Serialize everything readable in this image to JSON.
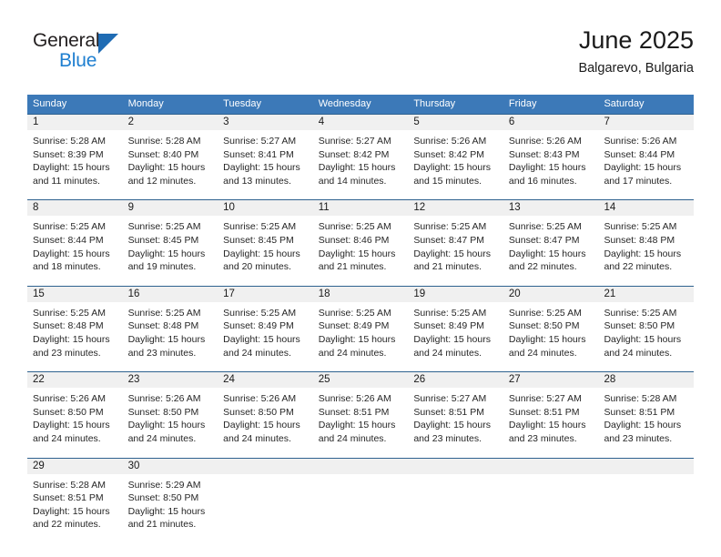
{
  "brand": {
    "name_top": "General",
    "name_bottom": "Blue",
    "triangle_icon": "triangle-icon",
    "colors": {
      "top_text": "#231f20",
      "bottom_text": "#1f7fd0",
      "triangle": "#1f6cb4"
    }
  },
  "header": {
    "title": "June 2025",
    "subtitle": "Balgarevo, Bulgaria"
  },
  "theme": {
    "header_blue": "#3c79b8",
    "rule_blue": "#2f628f",
    "day_band_gray": "#f0f0f0",
    "text": "#1a1a1a"
  },
  "weekdays": [
    "Sunday",
    "Monday",
    "Tuesday",
    "Wednesday",
    "Thursday",
    "Friday",
    "Saturday"
  ],
  "weeks": [
    [
      {
        "day": "1",
        "sunrise": "Sunrise: 5:28 AM",
        "sunset": "Sunset: 8:39 PM",
        "daylight1": "Daylight: 15 hours",
        "daylight2": "and 11 minutes."
      },
      {
        "day": "2",
        "sunrise": "Sunrise: 5:28 AM",
        "sunset": "Sunset: 8:40 PM",
        "daylight1": "Daylight: 15 hours",
        "daylight2": "and 12 minutes."
      },
      {
        "day": "3",
        "sunrise": "Sunrise: 5:27 AM",
        "sunset": "Sunset: 8:41 PM",
        "daylight1": "Daylight: 15 hours",
        "daylight2": "and 13 minutes."
      },
      {
        "day": "4",
        "sunrise": "Sunrise: 5:27 AM",
        "sunset": "Sunset: 8:42 PM",
        "daylight1": "Daylight: 15 hours",
        "daylight2": "and 14 minutes."
      },
      {
        "day": "5",
        "sunrise": "Sunrise: 5:26 AM",
        "sunset": "Sunset: 8:42 PM",
        "daylight1": "Daylight: 15 hours",
        "daylight2": "and 15 minutes."
      },
      {
        "day": "6",
        "sunrise": "Sunrise: 5:26 AM",
        "sunset": "Sunset: 8:43 PM",
        "daylight1": "Daylight: 15 hours",
        "daylight2": "and 16 minutes."
      },
      {
        "day": "7",
        "sunrise": "Sunrise: 5:26 AM",
        "sunset": "Sunset: 8:44 PM",
        "daylight1": "Daylight: 15 hours",
        "daylight2": "and 17 minutes."
      }
    ],
    [
      {
        "day": "8",
        "sunrise": "Sunrise: 5:25 AM",
        "sunset": "Sunset: 8:44 PM",
        "daylight1": "Daylight: 15 hours",
        "daylight2": "and 18 minutes."
      },
      {
        "day": "9",
        "sunrise": "Sunrise: 5:25 AM",
        "sunset": "Sunset: 8:45 PM",
        "daylight1": "Daylight: 15 hours",
        "daylight2": "and 19 minutes."
      },
      {
        "day": "10",
        "sunrise": "Sunrise: 5:25 AM",
        "sunset": "Sunset: 8:45 PM",
        "daylight1": "Daylight: 15 hours",
        "daylight2": "and 20 minutes."
      },
      {
        "day": "11",
        "sunrise": "Sunrise: 5:25 AM",
        "sunset": "Sunset: 8:46 PM",
        "daylight1": "Daylight: 15 hours",
        "daylight2": "and 21 minutes."
      },
      {
        "day": "12",
        "sunrise": "Sunrise: 5:25 AM",
        "sunset": "Sunset: 8:47 PM",
        "daylight1": "Daylight: 15 hours",
        "daylight2": "and 21 minutes."
      },
      {
        "day": "13",
        "sunrise": "Sunrise: 5:25 AM",
        "sunset": "Sunset: 8:47 PM",
        "daylight1": "Daylight: 15 hours",
        "daylight2": "and 22 minutes."
      },
      {
        "day": "14",
        "sunrise": "Sunrise: 5:25 AM",
        "sunset": "Sunset: 8:48 PM",
        "daylight1": "Daylight: 15 hours",
        "daylight2": "and 22 minutes."
      }
    ],
    [
      {
        "day": "15",
        "sunrise": "Sunrise: 5:25 AM",
        "sunset": "Sunset: 8:48 PM",
        "daylight1": "Daylight: 15 hours",
        "daylight2": "and 23 minutes."
      },
      {
        "day": "16",
        "sunrise": "Sunrise: 5:25 AM",
        "sunset": "Sunset: 8:48 PM",
        "daylight1": "Daylight: 15 hours",
        "daylight2": "and 23 minutes."
      },
      {
        "day": "17",
        "sunrise": "Sunrise: 5:25 AM",
        "sunset": "Sunset: 8:49 PM",
        "daylight1": "Daylight: 15 hours",
        "daylight2": "and 24 minutes."
      },
      {
        "day": "18",
        "sunrise": "Sunrise: 5:25 AM",
        "sunset": "Sunset: 8:49 PM",
        "daylight1": "Daylight: 15 hours",
        "daylight2": "and 24 minutes."
      },
      {
        "day": "19",
        "sunrise": "Sunrise: 5:25 AM",
        "sunset": "Sunset: 8:49 PM",
        "daylight1": "Daylight: 15 hours",
        "daylight2": "and 24 minutes."
      },
      {
        "day": "20",
        "sunrise": "Sunrise: 5:25 AM",
        "sunset": "Sunset: 8:50 PM",
        "daylight1": "Daylight: 15 hours",
        "daylight2": "and 24 minutes."
      },
      {
        "day": "21",
        "sunrise": "Sunrise: 5:25 AM",
        "sunset": "Sunset: 8:50 PM",
        "daylight1": "Daylight: 15 hours",
        "daylight2": "and 24 minutes."
      }
    ],
    [
      {
        "day": "22",
        "sunrise": "Sunrise: 5:26 AM",
        "sunset": "Sunset: 8:50 PM",
        "daylight1": "Daylight: 15 hours",
        "daylight2": "and 24 minutes."
      },
      {
        "day": "23",
        "sunrise": "Sunrise: 5:26 AM",
        "sunset": "Sunset: 8:50 PM",
        "daylight1": "Daylight: 15 hours",
        "daylight2": "and 24 minutes."
      },
      {
        "day": "24",
        "sunrise": "Sunrise: 5:26 AM",
        "sunset": "Sunset: 8:50 PM",
        "daylight1": "Daylight: 15 hours",
        "daylight2": "and 24 minutes."
      },
      {
        "day": "25",
        "sunrise": "Sunrise: 5:26 AM",
        "sunset": "Sunset: 8:51 PM",
        "daylight1": "Daylight: 15 hours",
        "daylight2": "and 24 minutes."
      },
      {
        "day": "26",
        "sunrise": "Sunrise: 5:27 AM",
        "sunset": "Sunset: 8:51 PM",
        "daylight1": "Daylight: 15 hours",
        "daylight2": "and 23 minutes."
      },
      {
        "day": "27",
        "sunrise": "Sunrise: 5:27 AM",
        "sunset": "Sunset: 8:51 PM",
        "daylight1": "Daylight: 15 hours",
        "daylight2": "and 23 minutes."
      },
      {
        "day": "28",
        "sunrise": "Sunrise: 5:28 AM",
        "sunset": "Sunset: 8:51 PM",
        "daylight1": "Daylight: 15 hours",
        "daylight2": "and 23 minutes."
      }
    ],
    [
      {
        "day": "29",
        "sunrise": "Sunrise: 5:28 AM",
        "sunset": "Sunset: 8:51 PM",
        "daylight1": "Daylight: 15 hours",
        "daylight2": "and 22 minutes."
      },
      {
        "day": "30",
        "sunrise": "Sunrise: 5:29 AM",
        "sunset": "Sunset: 8:50 PM",
        "daylight1": "Daylight: 15 hours",
        "daylight2": "and 21 minutes."
      },
      {
        "day": "",
        "sunrise": "",
        "sunset": "",
        "daylight1": "",
        "daylight2": ""
      },
      {
        "day": "",
        "sunrise": "",
        "sunset": "",
        "daylight1": "",
        "daylight2": ""
      },
      {
        "day": "",
        "sunrise": "",
        "sunset": "",
        "daylight1": "",
        "daylight2": ""
      },
      {
        "day": "",
        "sunrise": "",
        "sunset": "",
        "daylight1": "",
        "daylight2": ""
      },
      {
        "day": "",
        "sunrise": "",
        "sunset": "",
        "daylight1": "",
        "daylight2": ""
      }
    ]
  ]
}
